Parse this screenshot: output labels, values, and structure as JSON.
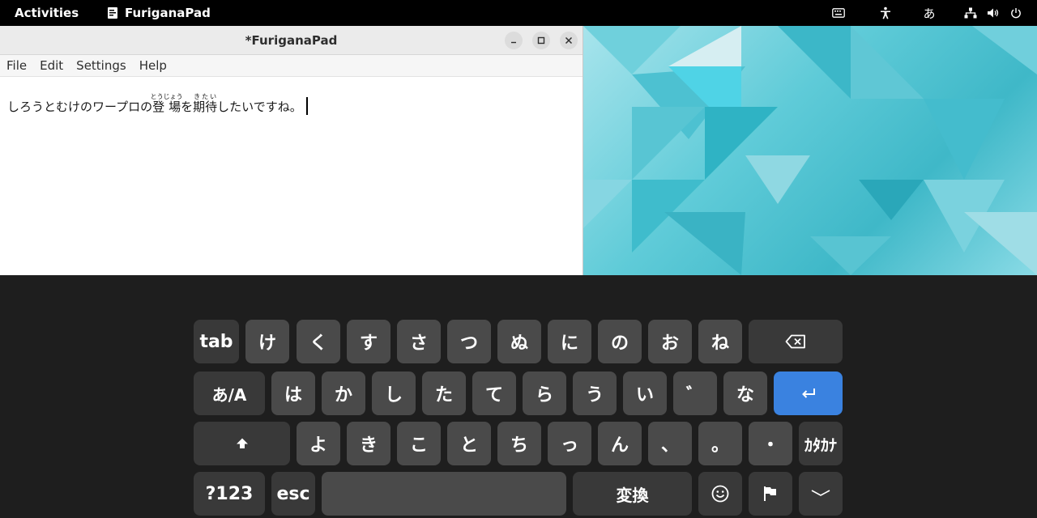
{
  "topbar": {
    "activities": "Activities",
    "app_name": "FuriganaPad",
    "input_method": "あ"
  },
  "window": {
    "title": "*FuriganaPad",
    "menus": [
      "File",
      "Edit",
      "Settings",
      "Help"
    ]
  },
  "editor": {
    "text_before": "しろうとむけのワープロの",
    "ruby1_base": "登場",
    "ruby1_reading": "とうじょう",
    "text_mid": "を",
    "ruby2_base": "期待",
    "ruby2_reading": "きたい",
    "text_after": "したいですね。"
  },
  "keyboard": {
    "row1": [
      "tab",
      "け",
      "く",
      "す",
      "さ",
      "つ",
      "ぬ",
      "に",
      "の",
      "お",
      "ね"
    ],
    "row2": [
      "あ/A",
      "は",
      "か",
      "し",
      "た",
      "て",
      "ら",
      "う",
      "い",
      "゛",
      "な"
    ],
    "row3": [
      "よ",
      "き",
      "こ",
      "と",
      "ち",
      "っ",
      "ん",
      "、",
      "。",
      "・",
      "ｶﾀｶﾅ"
    ],
    "row4": {
      "numbers": "?123",
      "esc": "esc",
      "convert": "変換"
    },
    "colors": {
      "key": "#4a4a4a",
      "key_dark": "#393939",
      "enter": "#3a82e0"
    }
  },
  "icons": {
    "app": "notepad-icon",
    "keyboard": "keyboard-icon",
    "accessibility": "accessibility-icon",
    "network": "network-icon",
    "volume": "volume-icon",
    "power": "power-icon",
    "backspace": "backspace-icon",
    "enter": "enter-icon",
    "shift": "shift-icon",
    "emoji": "emoji-icon",
    "flag": "flag-icon",
    "hide": "chevron-down-icon"
  }
}
